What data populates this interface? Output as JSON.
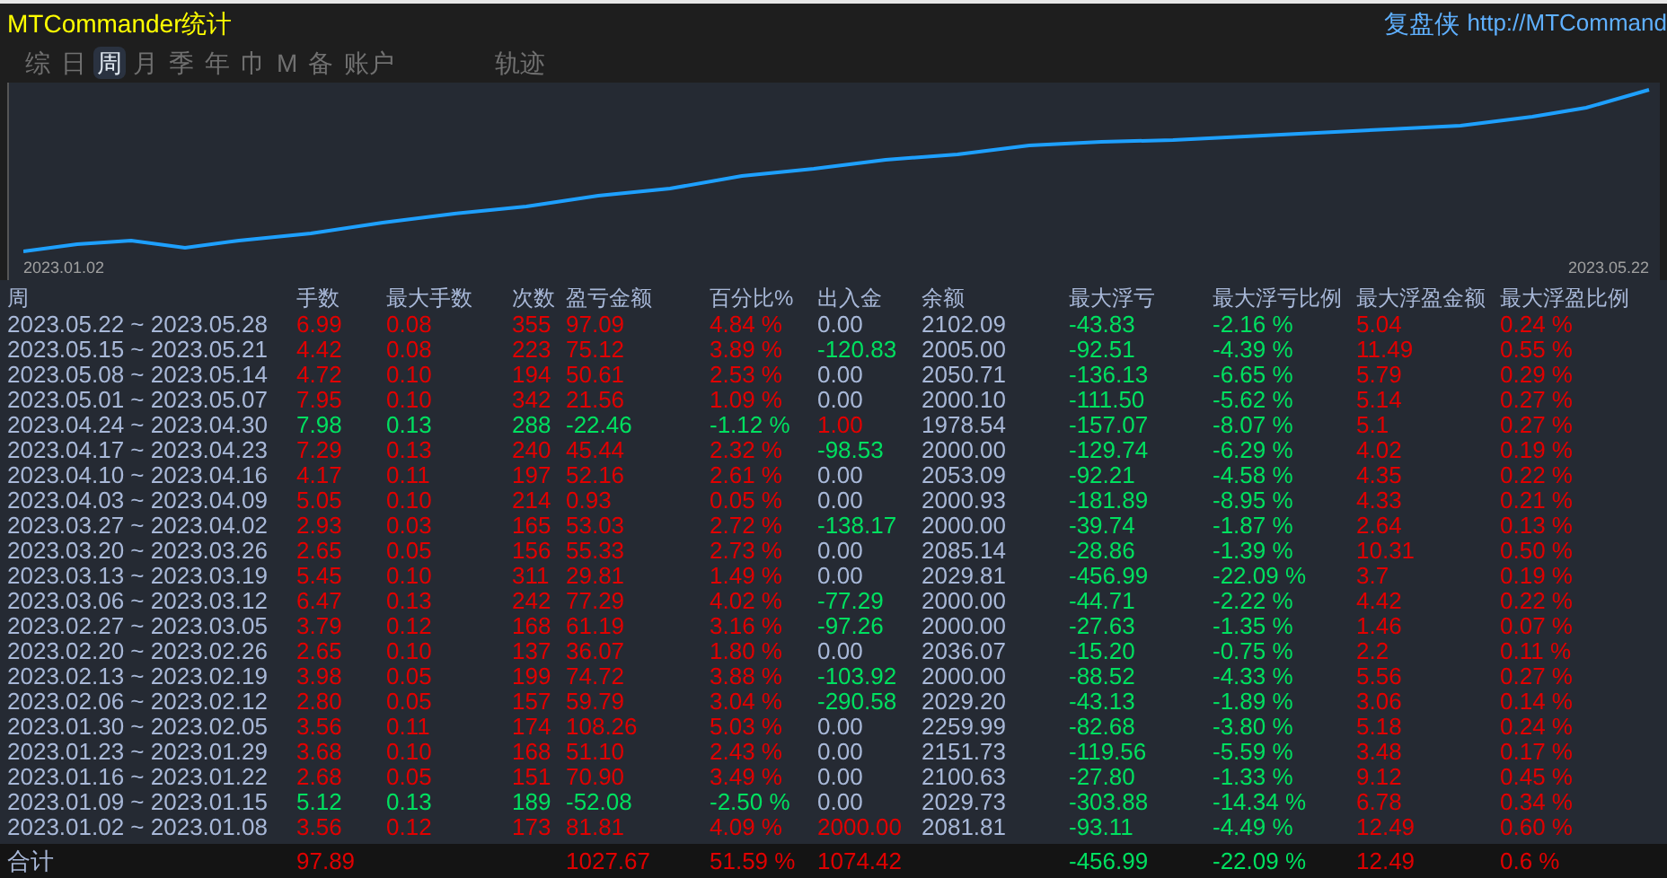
{
  "window": {
    "title": "MTCommander统计",
    "brand": "复盘侠",
    "url": "http://MTCommand"
  },
  "tabs": [
    {
      "label": "综",
      "selected": false
    },
    {
      "label": "日",
      "selected": false
    },
    {
      "label": "周",
      "selected": true
    },
    {
      "label": "月",
      "selected": false
    },
    {
      "label": "季",
      "selected": false
    },
    {
      "label": "年",
      "selected": false
    },
    {
      "label": "巾",
      "selected": false
    },
    {
      "label": "M",
      "selected": false
    },
    {
      "label": "备",
      "selected": false
    },
    {
      "label": "账户",
      "selected": false
    },
    {
      "label": "轨迹",
      "selected": false
    }
  ],
  "chart": {
    "start_label": "2023.01.02",
    "end_label": "2023.05.22"
  },
  "table": {
    "columns": [
      "周",
      "手数",
      "最大手数",
      "次数",
      "盈亏金额",
      "百分比%",
      "出入金",
      "余额",
      "最大浮亏",
      "最大浮亏比例",
      "最大浮盈金额",
      "最大浮盈比例"
    ],
    "rows": [
      {
        "profit": true,
        "deposit": false,
        "withdrawal": false,
        "cells": [
          "2023.05.22 ~ 2023.05.28",
          "6.99",
          "0.08",
          "355",
          "97.09",
          "4.84 %",
          "0.00",
          "2102.09",
          "-43.83",
          "-2.16 %",
          "5.04",
          "0.24 %"
        ]
      },
      {
        "profit": true,
        "deposit": false,
        "withdrawal": true,
        "cells": [
          "2023.05.15 ~ 2023.05.21",
          "4.42",
          "0.08",
          "223",
          "75.12",
          "3.89 %",
          "-120.83",
          "2005.00",
          "-92.51",
          "-4.39 %",
          "11.49",
          "0.55 %"
        ]
      },
      {
        "profit": true,
        "deposit": false,
        "withdrawal": false,
        "cells": [
          "2023.05.08 ~ 2023.05.14",
          "4.72",
          "0.10",
          "194",
          "50.61",
          "2.53 %",
          "0.00",
          "2050.71",
          "-136.13",
          "-6.65 %",
          "5.79",
          "0.29 %"
        ]
      },
      {
        "profit": true,
        "deposit": false,
        "withdrawal": false,
        "cells": [
          "2023.05.01 ~ 2023.05.07",
          "7.95",
          "0.10",
          "342",
          "21.56",
          "1.09 %",
          "0.00",
          "2000.10",
          "-111.50",
          "-5.62 %",
          "5.14",
          "0.27 %"
        ]
      },
      {
        "profit": false,
        "deposit": true,
        "withdrawal": false,
        "cells": [
          "2023.04.24 ~ 2023.04.30",
          "7.98",
          "0.13",
          "288",
          "-22.46",
          "-1.12 %",
          "1.00",
          "1978.54",
          "-157.07",
          "-8.07 %",
          "5.1",
          "0.27 %"
        ]
      },
      {
        "profit": true,
        "deposit": false,
        "withdrawal": true,
        "cells": [
          "2023.04.17 ~ 2023.04.23",
          "7.29",
          "0.13",
          "240",
          "45.44",
          "2.32 %",
          "-98.53",
          "2000.00",
          "-129.74",
          "-6.29 %",
          "4.02",
          "0.19 %"
        ]
      },
      {
        "profit": true,
        "deposit": false,
        "withdrawal": false,
        "cells": [
          "2023.04.10 ~ 2023.04.16",
          "4.17",
          "0.11",
          "197",
          "52.16",
          "2.61 %",
          "0.00",
          "2053.09",
          "-92.21",
          "-4.58 %",
          "4.35",
          "0.22 %"
        ]
      },
      {
        "profit": true,
        "deposit": false,
        "withdrawal": false,
        "cells": [
          "2023.04.03 ~ 2023.04.09",
          "5.05",
          "0.10",
          "214",
          "0.93",
          "0.05 %",
          "0.00",
          "2000.93",
          "-181.89",
          "-8.95 %",
          "4.33",
          "0.21 %"
        ]
      },
      {
        "profit": true,
        "deposit": false,
        "withdrawal": true,
        "cells": [
          "2023.03.27 ~ 2023.04.02",
          "2.93",
          "0.03",
          "165",
          "53.03",
          "2.72 %",
          "-138.17",
          "2000.00",
          "-39.74",
          "-1.87 %",
          "2.64",
          "0.13 %"
        ]
      },
      {
        "profit": true,
        "deposit": false,
        "withdrawal": false,
        "cells": [
          "2023.03.20 ~ 2023.03.26",
          "2.65",
          "0.05",
          "156",
          "55.33",
          "2.73 %",
          "0.00",
          "2085.14",
          "-28.86",
          "-1.39 %",
          "10.31",
          "0.50 %"
        ]
      },
      {
        "profit": true,
        "deposit": false,
        "withdrawal": false,
        "cells": [
          "2023.03.13 ~ 2023.03.19",
          "5.45",
          "0.10",
          "311",
          "29.81",
          "1.49 %",
          "0.00",
          "2029.81",
          "-456.99",
          "-22.09 %",
          "3.7",
          "0.19 %"
        ]
      },
      {
        "profit": true,
        "deposit": false,
        "withdrawal": true,
        "cells": [
          "2023.03.06 ~ 2023.03.12",
          "6.47",
          "0.13",
          "242",
          "77.29",
          "4.02 %",
          "-77.29",
          "2000.00",
          "-44.71",
          "-2.22 %",
          "4.42",
          "0.22 %"
        ]
      },
      {
        "profit": true,
        "deposit": false,
        "withdrawal": true,
        "cells": [
          "2023.02.27 ~ 2023.03.05",
          "3.79",
          "0.12",
          "168",
          "61.19",
          "3.16 %",
          "-97.26",
          "2000.00",
          "-27.63",
          "-1.35 %",
          "1.46",
          "0.07 %"
        ]
      },
      {
        "profit": true,
        "deposit": false,
        "withdrawal": false,
        "cells": [
          "2023.02.20 ~ 2023.02.26",
          "2.65",
          "0.10",
          "137",
          "36.07",
          "1.80 %",
          "0.00",
          "2036.07",
          "-15.20",
          "-0.75 %",
          "2.2",
          "0.11 %"
        ]
      },
      {
        "profit": true,
        "deposit": false,
        "withdrawal": true,
        "cells": [
          "2023.02.13 ~ 2023.02.19",
          "3.98",
          "0.05",
          "199",
          "74.72",
          "3.88 %",
          "-103.92",
          "2000.00",
          "-88.52",
          "-4.33 %",
          "5.56",
          "0.27 %"
        ]
      },
      {
        "profit": true,
        "deposit": false,
        "withdrawal": true,
        "cells": [
          "2023.02.06 ~ 2023.02.12",
          "2.80",
          "0.05",
          "157",
          "59.79",
          "3.04 %",
          "-290.58",
          "2029.20",
          "-43.13",
          "-1.89 %",
          "3.06",
          "0.14 %"
        ]
      },
      {
        "profit": true,
        "deposit": false,
        "withdrawal": false,
        "cells": [
          "2023.01.30 ~ 2023.02.05",
          "3.56",
          "0.11",
          "174",
          "108.26",
          "5.03 %",
          "0.00",
          "2259.99",
          "-82.68",
          "-3.80 %",
          "5.18",
          "0.24 %"
        ]
      },
      {
        "profit": true,
        "deposit": false,
        "withdrawal": false,
        "cells": [
          "2023.01.23 ~ 2023.01.29",
          "3.68",
          "0.10",
          "168",
          "51.10",
          "2.43 %",
          "0.00",
          "2151.73",
          "-119.56",
          "-5.59 %",
          "3.48",
          "0.17 %"
        ]
      },
      {
        "profit": true,
        "deposit": false,
        "withdrawal": false,
        "cells": [
          "2023.01.16 ~ 2023.01.22",
          "2.68",
          "0.05",
          "151",
          "70.90",
          "3.49 %",
          "0.00",
          "2100.63",
          "-27.80",
          "-1.33 %",
          "9.12",
          "0.45 %"
        ]
      },
      {
        "profit": false,
        "deposit": false,
        "withdrawal": false,
        "cells": [
          "2023.01.09 ~ 2023.01.15",
          "5.12",
          "0.13",
          "189",
          "-52.08",
          "-2.50 %",
          "0.00",
          "2029.73",
          "-303.88",
          "-14.34 %",
          "6.78",
          "0.34 %"
        ]
      },
      {
        "profit": true,
        "deposit": true,
        "withdrawal": false,
        "cells": [
          "2023.01.02 ~ 2023.01.08",
          "3.56",
          "0.12",
          "173",
          "81.81",
          "4.09 %",
          "2000.00",
          "2081.81",
          "-93.11",
          "-4.49 %",
          "12.49",
          "0.60 %"
        ]
      }
    ],
    "total": {
      "label": "合计",
      "lots": "97.89",
      "pnl": "1027.67",
      "percent": "51.59 %",
      "flow": "1074.42",
      "max_loss": "-456.99",
      "max_loss_pct": "-22.09 %",
      "max_gain": "12.49",
      "max_gain_pct": "0.6 %"
    }
  }
}
